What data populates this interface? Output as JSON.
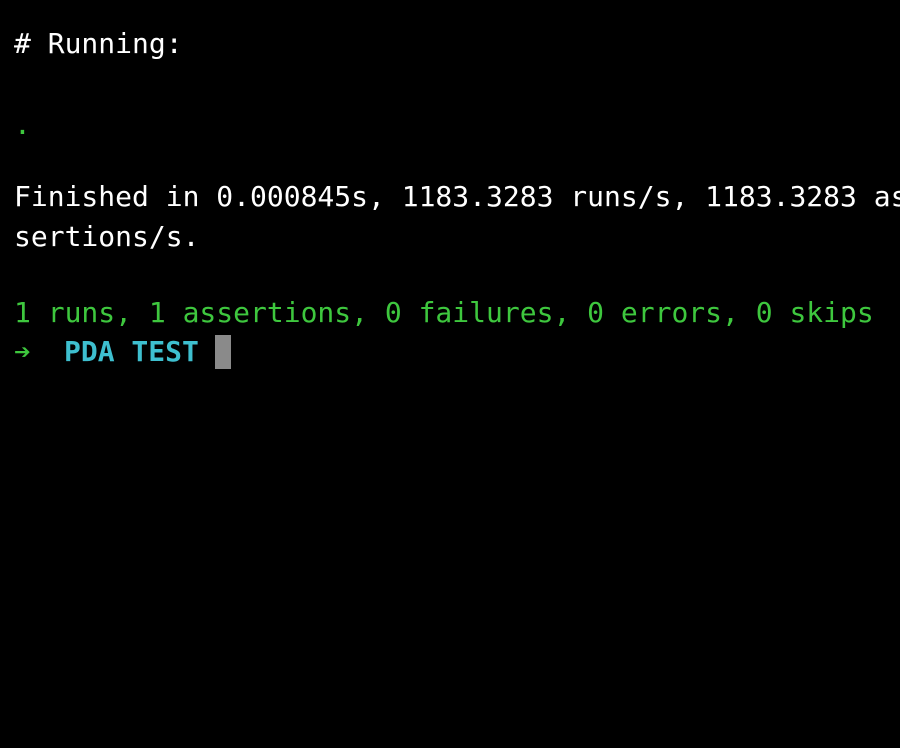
{
  "terminal": {
    "running_header": "# Running:",
    "progress_dot": ".",
    "finished_line_1": "Finished in 0.000845s, 1183.3283 runs/s, 1183.3283 as",
    "finished_line_2": "sertions/s.",
    "summary": "1 runs, 1 assertions, 0 failures, 0 errors, 0 skips",
    "prompt": {
      "arrow": "➔",
      "directory": "PDA TEST"
    },
    "colors": {
      "background": "#000000",
      "text": "#ffffff",
      "success": "#3ec73e",
      "directory": "#3ebfcf",
      "cursor": "#8a8a8a"
    },
    "icons": {
      "prompt_arrow": "arrow-right-icon",
      "cursor": "block-cursor"
    }
  }
}
